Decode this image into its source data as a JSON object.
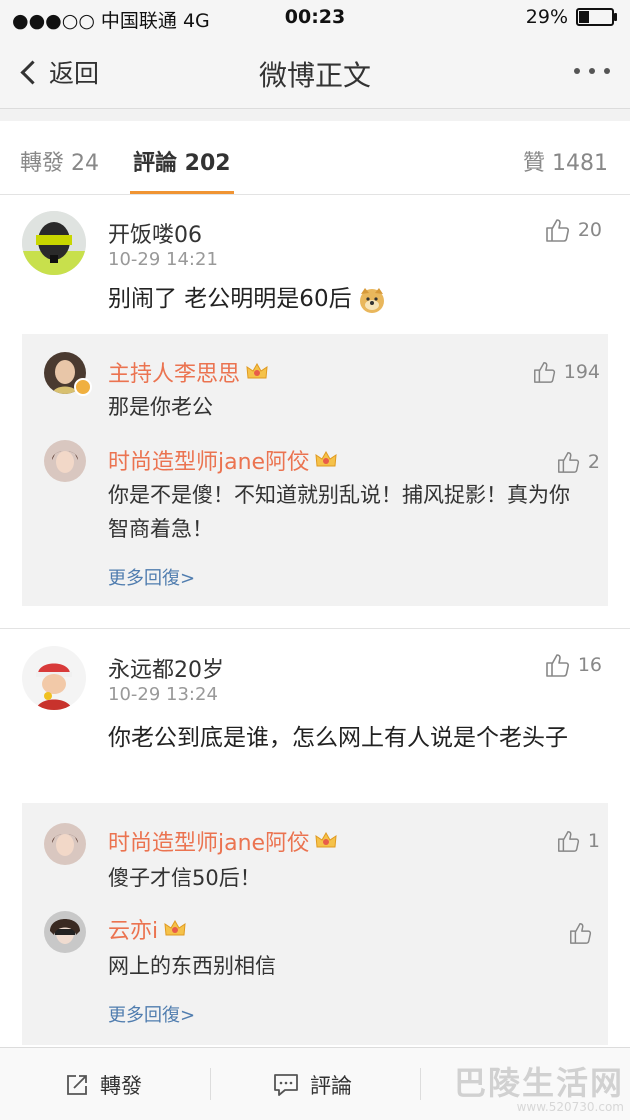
{
  "status": {
    "carrier": "●●●○○ 中国联通  4G",
    "time": "00:23",
    "battery": "29%",
    "battery_level": 0.29
  },
  "nav": {
    "back_label": "返回",
    "title": "微博正文"
  },
  "tabs": {
    "repost": "轉發 24",
    "comments": "評論 202",
    "likes": "贊 1481"
  },
  "comments": [
    {
      "user": "开饭喽06",
      "time": "10-29 14:21",
      "likes": "20",
      "text": "别闹了   老公明明是60后",
      "replies": [
        {
          "user": "主持人李思思",
          "text": "那是你老公",
          "likes": "194"
        },
        {
          "user": "时尚造型师jane阿佼",
          "text": "你是不是傻！不知道就别乱说！捕风捉影！真为你智商着急！",
          "likes": "2"
        }
      ],
      "more_replies": "更多回復>"
    },
    {
      "user": "永远都20岁",
      "time": "10-29 13:24",
      "likes": "16",
      "text": "你老公到底是谁，怎么网上有人说是个老头子",
      "replies": [
        {
          "user": "时尚造型师jane阿佼",
          "text": "傻子才信50后！",
          "likes": "1"
        },
        {
          "user": "云亦i",
          "text": "网上的东西别相信",
          "likes": ""
        }
      ],
      "more_replies": "更多回復>"
    }
  ],
  "bottom": {
    "repost_label": "轉發",
    "comment_label": "評論"
  },
  "watermark": {
    "text": "巴陵生活网",
    "url": "www.520730.com"
  },
  "colors": {
    "accent": "#f09433",
    "reply_name": "#eb7350",
    "link": "#507daf"
  }
}
